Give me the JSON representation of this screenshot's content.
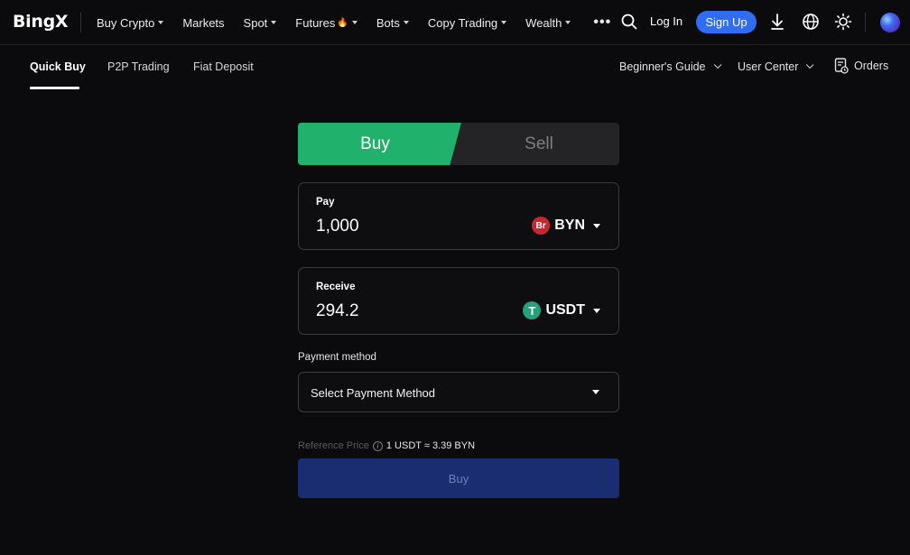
{
  "header": {
    "logo": "BingX",
    "nav": [
      {
        "label": "Buy Crypto",
        "dropdown": true
      },
      {
        "label": "Markets",
        "dropdown": false
      },
      {
        "label": "Spot",
        "dropdown": true
      },
      {
        "label": "Futures",
        "dropdown": true,
        "badge": "fire"
      },
      {
        "label": "Bots",
        "dropdown": true
      },
      {
        "label": "Copy Trading",
        "dropdown": true
      },
      {
        "label": "Wealth",
        "dropdown": true
      }
    ],
    "more": "•••",
    "login_label": "Log In",
    "signup_label": "Sign Up",
    "icons": [
      "search-icon",
      "download-icon",
      "globe-icon",
      "theme-sun-icon",
      "profile-orb-icon"
    ]
  },
  "subnav": {
    "tabs": [
      "Quick Buy",
      "P2P Trading",
      "Fiat Deposit"
    ],
    "active_tab": "Quick Buy",
    "beginners_guide": "Beginner's Guide",
    "user_center": "User Center",
    "orders": "Orders"
  },
  "trade": {
    "buy_tab": "Buy",
    "sell_tab": "Sell",
    "active": "Buy",
    "pay": {
      "label": "Pay",
      "value": "1,000",
      "currency": "BYN",
      "currency_icon": "Br"
    },
    "receive": {
      "label": "Receive",
      "value": "294.2",
      "currency": "USDT",
      "currency_icon": "T"
    },
    "payment_method_label": "Payment method",
    "payment_method_placeholder": "Select Payment Method",
    "reference_label": "Reference Price",
    "reference_value": "1 USDT ≈ 3.39 BYN",
    "submit_label": "Buy"
  },
  "colors": {
    "background": "#0b0b0d",
    "buy_green": "#20b26c",
    "signup_blue": "#2f6df6",
    "buy_button_disabled": "#1a2d70",
    "byn_red": "#c7272f",
    "usdt_green": "#26a17b"
  }
}
